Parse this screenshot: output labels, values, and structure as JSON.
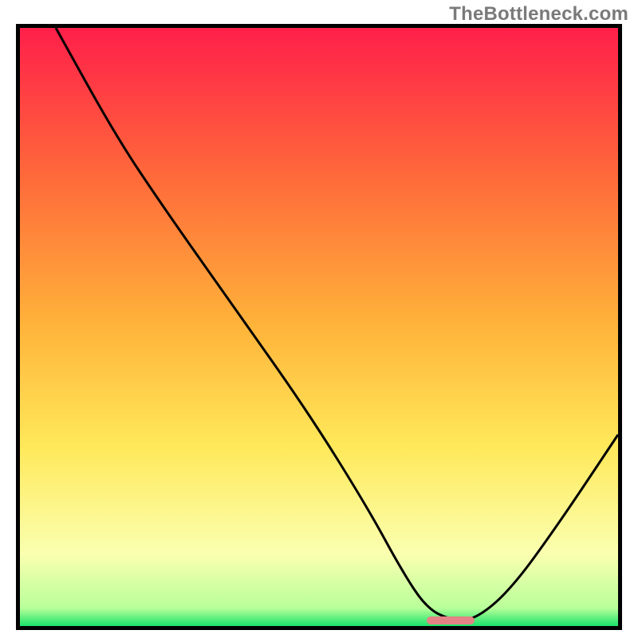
{
  "watermark": "TheBottleneck.com",
  "colors": {
    "grad_top": "#ff1f4a",
    "grad_mid1": "#ff6a3a",
    "grad_mid2": "#ffb43a",
    "grad_mid3": "#ffe95a",
    "grad_pale": "#faffb0",
    "grad_green": "#19e36a",
    "curve": "#000000",
    "marker": "#e38385",
    "border": "#000000"
  },
  "chart_data": {
    "type": "line",
    "title": "",
    "xlabel": "",
    "ylabel": "",
    "xlim": [
      0,
      100
    ],
    "ylim": [
      0,
      100
    ],
    "series": [
      {
        "name": "bottleneck-curve",
        "x": [
          6,
          16,
          24,
          36,
          48,
          58,
          64,
          68,
          72,
          76,
          82,
          90,
          100
        ],
        "values": [
          100,
          82,
          70,
          53,
          36,
          20,
          9,
          3,
          1,
          1,
          6,
          17,
          32
        ]
      }
    ],
    "marker": {
      "x_start": 68,
      "x_end": 76,
      "y": 0.9
    },
    "gradient_stops": [
      {
        "pct": 0,
        "color": "#ff1f4a"
      },
      {
        "pct": 25,
        "color": "#ff6a3a"
      },
      {
        "pct": 50,
        "color": "#ffb43a"
      },
      {
        "pct": 70,
        "color": "#ffe95a"
      },
      {
        "pct": 88,
        "color": "#faffb0"
      },
      {
        "pct": 97,
        "color": "#b8ff9a"
      },
      {
        "pct": 100,
        "color": "#19e36a"
      }
    ]
  }
}
